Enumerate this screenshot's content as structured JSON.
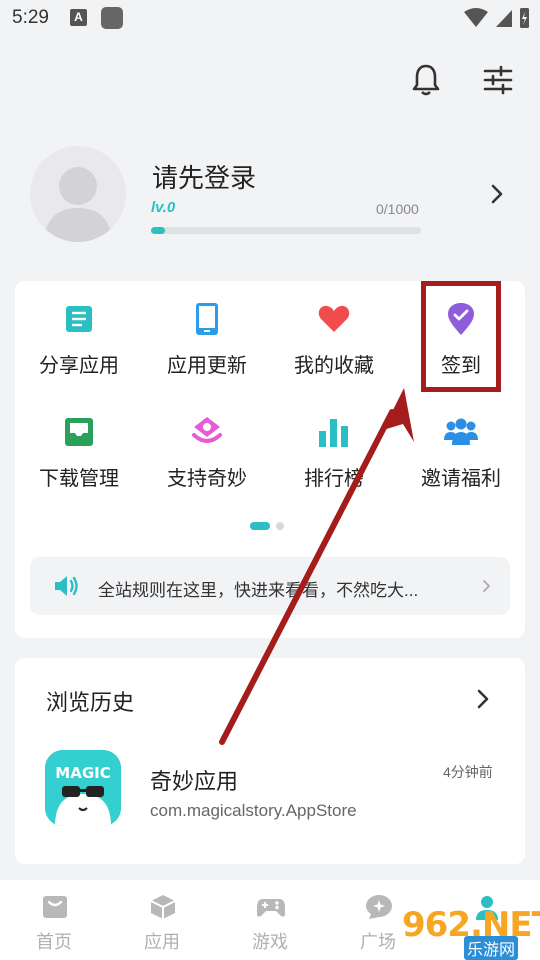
{
  "status": {
    "time": "5:29",
    "notif_letter": "A"
  },
  "profile": {
    "login_prompt": "请先登录",
    "level": "lv.0",
    "exp": "0/1000",
    "exp_progress": 0.0
  },
  "grid": {
    "items": [
      {
        "label": "分享应用",
        "icon": "document-icon",
        "color": "#2bbfc3"
      },
      {
        "label": "应用更新",
        "icon": "phone-icon",
        "color": "#2b9bea"
      },
      {
        "label": "我的收藏",
        "icon": "heart-icon",
        "color": "#f14c4c"
      },
      {
        "label": "签到",
        "icon": "checkin-pin-icon",
        "color": "#8f5cdb"
      },
      {
        "label": "下载管理",
        "icon": "inbox-icon",
        "color": "#2aa15b"
      },
      {
        "label": "支持奇妙",
        "icon": "gift-icon",
        "color": "#e55dd6"
      },
      {
        "label": "排行榜",
        "icon": "bar-chart-icon",
        "color": "#2bbfc3"
      },
      {
        "label": "邀请福利",
        "icon": "group-icon",
        "color": "#2b8fe6"
      }
    ],
    "page_indicator": {
      "current": 1,
      "total": 2
    }
  },
  "notice": {
    "text": "全站规则在这里，快进来看看，不然吃大..."
  },
  "history": {
    "title": "浏览历史",
    "items": [
      {
        "name": "奇妙应用",
        "package": "com.magicalstory.AppStore",
        "time": "4分钟前",
        "icon_text": "MAGIC"
      }
    ]
  },
  "tabs": [
    {
      "label": "首页",
      "icon": "home-icon"
    },
    {
      "label": "应用",
      "icon": "box-icon"
    },
    {
      "label": "游戏",
      "icon": "gamepad-icon"
    },
    {
      "label": "广场",
      "icon": "chat-icon"
    },
    {
      "label": "",
      "icon": "profile-icon"
    }
  ],
  "watermark": {
    "text": "962.NET",
    "sub": "乐游网"
  },
  "colors": {
    "accent": "#2bbfc3",
    "annotation": "#a51c1c"
  }
}
